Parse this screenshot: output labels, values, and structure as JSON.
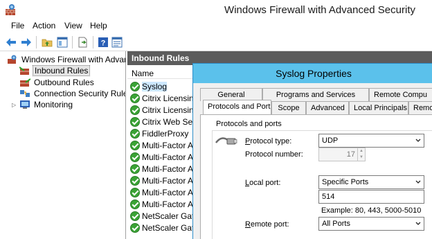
{
  "window": {
    "title": "Windows Firewall with Advanced Security"
  },
  "menu": [
    "File",
    "Action",
    "View",
    "Help"
  ],
  "toolbar": [
    "back-arrow-icon",
    "forward-arrow-icon",
    "up-folder-icon",
    "show-hide-tree-icon",
    "export-list-icon",
    "help-icon",
    "properties-icon"
  ],
  "tree": {
    "root": "Windows Firewall with Advance",
    "items": [
      {
        "label": "Inbound Rules",
        "selected": true
      },
      {
        "label": "Outbound Rules",
        "selected": false
      },
      {
        "label": "Connection Security Rules",
        "selected": false
      },
      {
        "label": "Monitoring",
        "selected": false
      }
    ]
  },
  "list": {
    "header": "Inbound Rules",
    "column": "Name",
    "rows": [
      "Syslog",
      "Citrix Licensing",
      "Citrix Licensing",
      "Citrix Web Serv",
      "FiddlerProxy",
      "Multi-Factor Au",
      "Multi-Factor Au",
      "Multi-Factor Au",
      "Multi-Factor Au",
      "Multi-Factor Au",
      "Multi-Factor Au",
      "NetScaler Gatew",
      "NetScaler Gatew"
    ]
  },
  "dialog": {
    "title": "Syslog Properties",
    "tabs_back": [
      "General",
      "Programs and Services",
      "Remote Compu"
    ],
    "tabs_front": [
      "Protocols and Ports",
      "Scope",
      "Advanced",
      "Local Principals",
      "Remot"
    ],
    "active_tab": "Protocols and Ports",
    "group_label": "Protocols and ports",
    "protocol_type_label": "Protocol type:",
    "protocol_type_key": "P",
    "protocol_type_rest": "rotocol type:",
    "protocol_type_value": "UDP",
    "protocol_number_label": "Protocol number:",
    "protocol_number_value": "17",
    "local_port_key": "L",
    "local_port_rest": "ocal port:",
    "local_port_value": "Specific Ports",
    "local_port_text": "514",
    "example": "Example: 80, 443, 5000-5010",
    "remote_port_key": "R",
    "remote_port_rest": "emote port:",
    "remote_port_value": "All Ports"
  },
  "colors": {
    "dialog_title": "#5bc1eb",
    "rule_enabled": "#3aa335",
    "list_header": "#5c5c5c"
  }
}
